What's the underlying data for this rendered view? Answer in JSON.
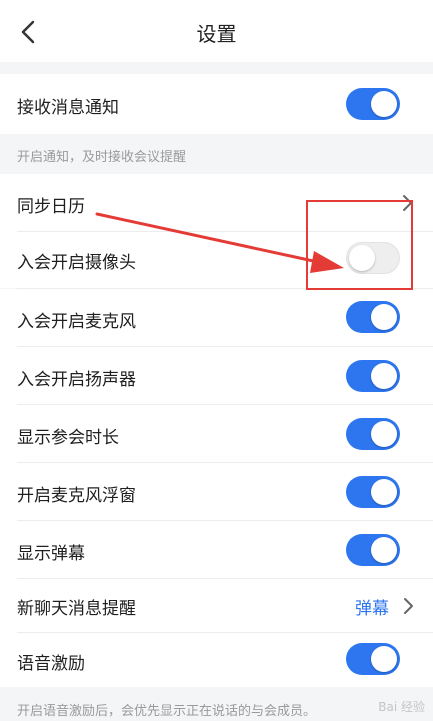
{
  "header": {
    "title": "设置"
  },
  "settings": {
    "receive_notify": {
      "label": "接收消息通知",
      "on": true
    },
    "receive_notify_note": "开启通知，及时接收会议提醒",
    "sync_calendar": {
      "label": "同步日历"
    },
    "camera": {
      "label": "入会开启摄像头",
      "on": false
    },
    "mic": {
      "label": "入会开启麦克风",
      "on": true
    },
    "speaker": {
      "label": "入会开启扬声器",
      "on": true
    },
    "duration": {
      "label": "显示参会时长",
      "on": true
    },
    "mic_float": {
      "label": "开启麦克风浮窗",
      "on": true
    },
    "danmaku": {
      "label": "显示弹幕",
      "on": true
    },
    "chat_remind": {
      "label": "新聊天消息提醒",
      "value": "弹幕"
    },
    "voice_excite": {
      "label": "语音激励",
      "on": true
    },
    "voice_excite_note": "开启语音激励后，会优先显示正在说话的与会成员。"
  },
  "watermark": "Bai 经验",
  "colors": {
    "accent": "#2d76f0",
    "annotation": "#e43b37",
    "page_bg": "#f4f5f7"
  }
}
